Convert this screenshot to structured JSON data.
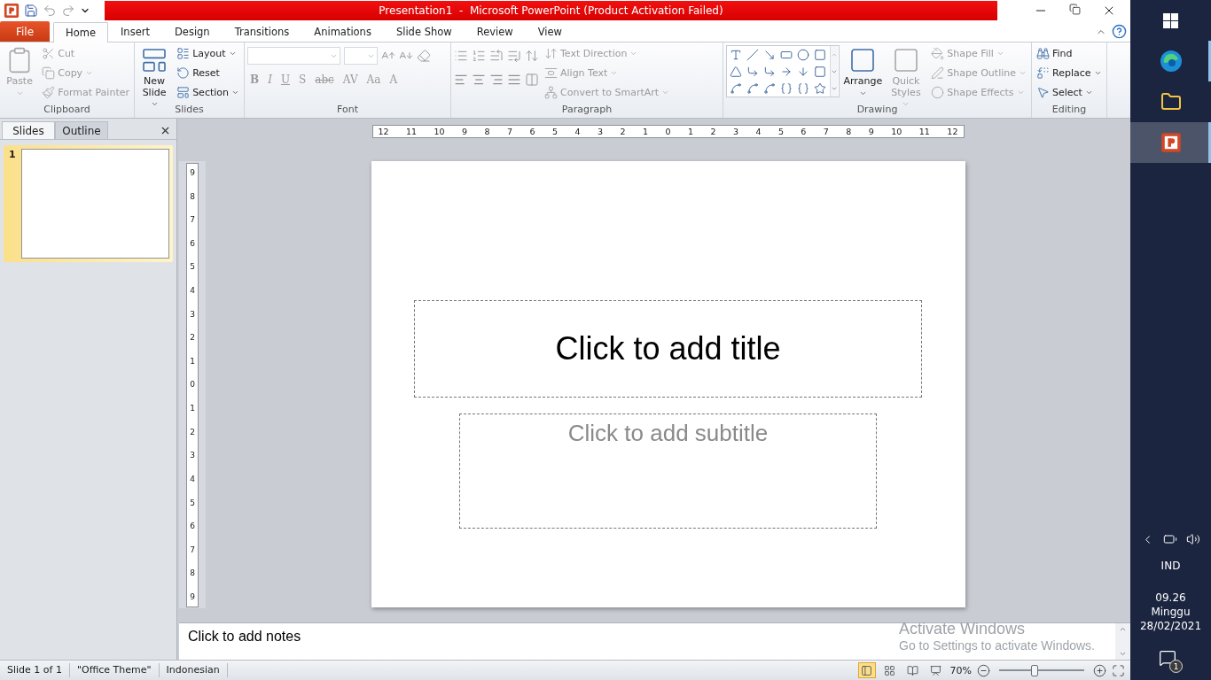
{
  "window": {
    "title": "Presentation1  -  Microsoft PowerPoint (Product Activation Failed)"
  },
  "tabs": [
    {
      "label": "File",
      "kind": "file",
      "selected": false
    },
    {
      "label": "Home",
      "kind": "tab",
      "selected": true
    },
    {
      "label": "Insert",
      "kind": "tab",
      "selected": false
    },
    {
      "label": "Design",
      "kind": "tab",
      "selected": false
    },
    {
      "label": "Transitions",
      "kind": "tab",
      "selected": false
    },
    {
      "label": "Animations",
      "kind": "tab",
      "selected": false
    },
    {
      "label": "Slide Show",
      "kind": "tab",
      "selected": false
    },
    {
      "label": "Review",
      "kind": "tab",
      "selected": false
    },
    {
      "label": "View",
      "kind": "tab",
      "selected": false
    }
  ],
  "ribbon": {
    "groups": [
      {
        "label": "Clipboard",
        "kind": "clipboard",
        "buttons": [
          {
            "label": "Paste",
            "kind": "large",
            "disabled": true,
            "dropdown": true
          },
          {
            "label": "Cut",
            "kind": "small",
            "disabled": true,
            "dropdown": false
          },
          {
            "label": "Copy",
            "kind": "small",
            "disabled": true,
            "dropdown": true
          },
          {
            "label": "Format Painter",
            "kind": "small",
            "disabled": true,
            "dropdown": false
          }
        ]
      },
      {
        "label": "Slides",
        "kind": "slides",
        "buttons": [
          {
            "label": "New Slide",
            "kind": "large",
            "disabled": false,
            "dropdown": true
          },
          {
            "label": "Layout",
            "kind": "small",
            "disabled": false,
            "dropdown": true
          },
          {
            "label": "Reset",
            "kind": "small",
            "disabled": false,
            "dropdown": false
          },
          {
            "label": "Section",
            "kind": "small",
            "disabled": false,
            "dropdown": true
          }
        ]
      },
      {
        "label": "Font",
        "kind": "font",
        "format_buttons": [
          {
            "label": "B",
            "disabled": true
          },
          {
            "label": "I",
            "disabled": true
          },
          {
            "label": "U",
            "disabled": true
          },
          {
            "label": "S",
            "disabled": true
          },
          {
            "label": "abc",
            "disabled": true
          },
          {
            "label": "AV",
            "disabled": true
          },
          {
            "label": "Aa",
            "disabled": true
          },
          {
            "label": "A",
            "disabled": true
          }
        ]
      },
      {
        "label": "Paragraph",
        "kind": "paragraph",
        "buttons": [
          {
            "label": "Text Direction",
            "kind": "small",
            "disabled": true,
            "dropdown": true
          },
          {
            "label": "Align Text",
            "kind": "small",
            "disabled": true,
            "dropdown": true
          },
          {
            "label": "Convert to SmartArt",
            "kind": "small",
            "disabled": true,
            "dropdown": true
          }
        ]
      },
      {
        "label": "Drawing",
        "kind": "drawing",
        "buttons": [
          {
            "label": "Arrange",
            "kind": "large",
            "disabled": false,
            "dropdown": true
          },
          {
            "label": "Quick Styles",
            "kind": "large",
            "disabled": true,
            "dropdown": true
          },
          {
            "label": "Shape Fill",
            "kind": "small",
            "disabled": true,
            "dropdown": true
          },
          {
            "label": "Shape Outline",
            "kind": "small",
            "disabled": true,
            "dropdown": true
          },
          {
            "label": "Shape Effects",
            "kind": "small",
            "disabled": true,
            "dropdown": true
          }
        ]
      },
      {
        "label": "Editing",
        "kind": "editing",
        "buttons": [
          {
            "label": "Find",
            "kind": "small",
            "disabled": false,
            "dropdown": false
          },
          {
            "label": "Replace",
            "kind": "small",
            "disabled": false,
            "dropdown": true
          },
          {
            "label": "Select",
            "kind": "small",
            "disabled": false,
            "dropdown": true
          }
        ]
      }
    ]
  },
  "slide_pane": {
    "tabs": [
      {
        "label": "Slides",
        "selected": true
      },
      {
        "label": "Outline",
        "selected": false
      }
    ],
    "thumbnails": [
      {
        "number": "1",
        "selected": true
      }
    ]
  },
  "rulers": {
    "horizontal": [
      "12",
      "11",
      "10",
      "9",
      "8",
      "7",
      "6",
      "5",
      "4",
      "3",
      "2",
      "1",
      "0",
      "1",
      "2",
      "3",
      "4",
      "5",
      "6",
      "7",
      "8",
      "9",
      "10",
      "11",
      "12"
    ],
    "vertical": [
      "9",
      "8",
      "7",
      "6",
      "5",
      "4",
      "3",
      "2",
      "1",
      "0",
      "1",
      "2",
      "3",
      "4",
      "5",
      "6",
      "7",
      "8",
      "9"
    ]
  },
  "slide": {
    "title": "Click to add title",
    "subtitle": "Click to add subtitle"
  },
  "notes": {
    "prompt": "Click to add notes"
  },
  "activation": {
    "title": "Activate Windows",
    "message": "Go to Settings to activate Windows."
  },
  "status_bar": {
    "slide_info": "Slide 1 of 1",
    "theme": "\"Office Theme\"",
    "language": "Indonesian",
    "views": [
      {
        "selected": true
      },
      {
        "selected": false
      },
      {
        "selected": false
      },
      {
        "selected": false
      }
    ],
    "zoom": "70%",
    "zoom_slider": {
      "level": 0.42
    }
  },
  "taskbar": {
    "apps": [
      {
        "kind": "start",
        "running": false,
        "selected": false
      },
      {
        "kind": "browser",
        "running": true,
        "selected": false
      },
      {
        "kind": "folder",
        "running": false,
        "selected": false
      },
      {
        "kind": "powerpoint",
        "running": true,
        "selected": true
      }
    ],
    "language": "IND",
    "time": "09.26",
    "day": "Minggu",
    "date": "28/02/2021",
    "notifications": "1"
  }
}
